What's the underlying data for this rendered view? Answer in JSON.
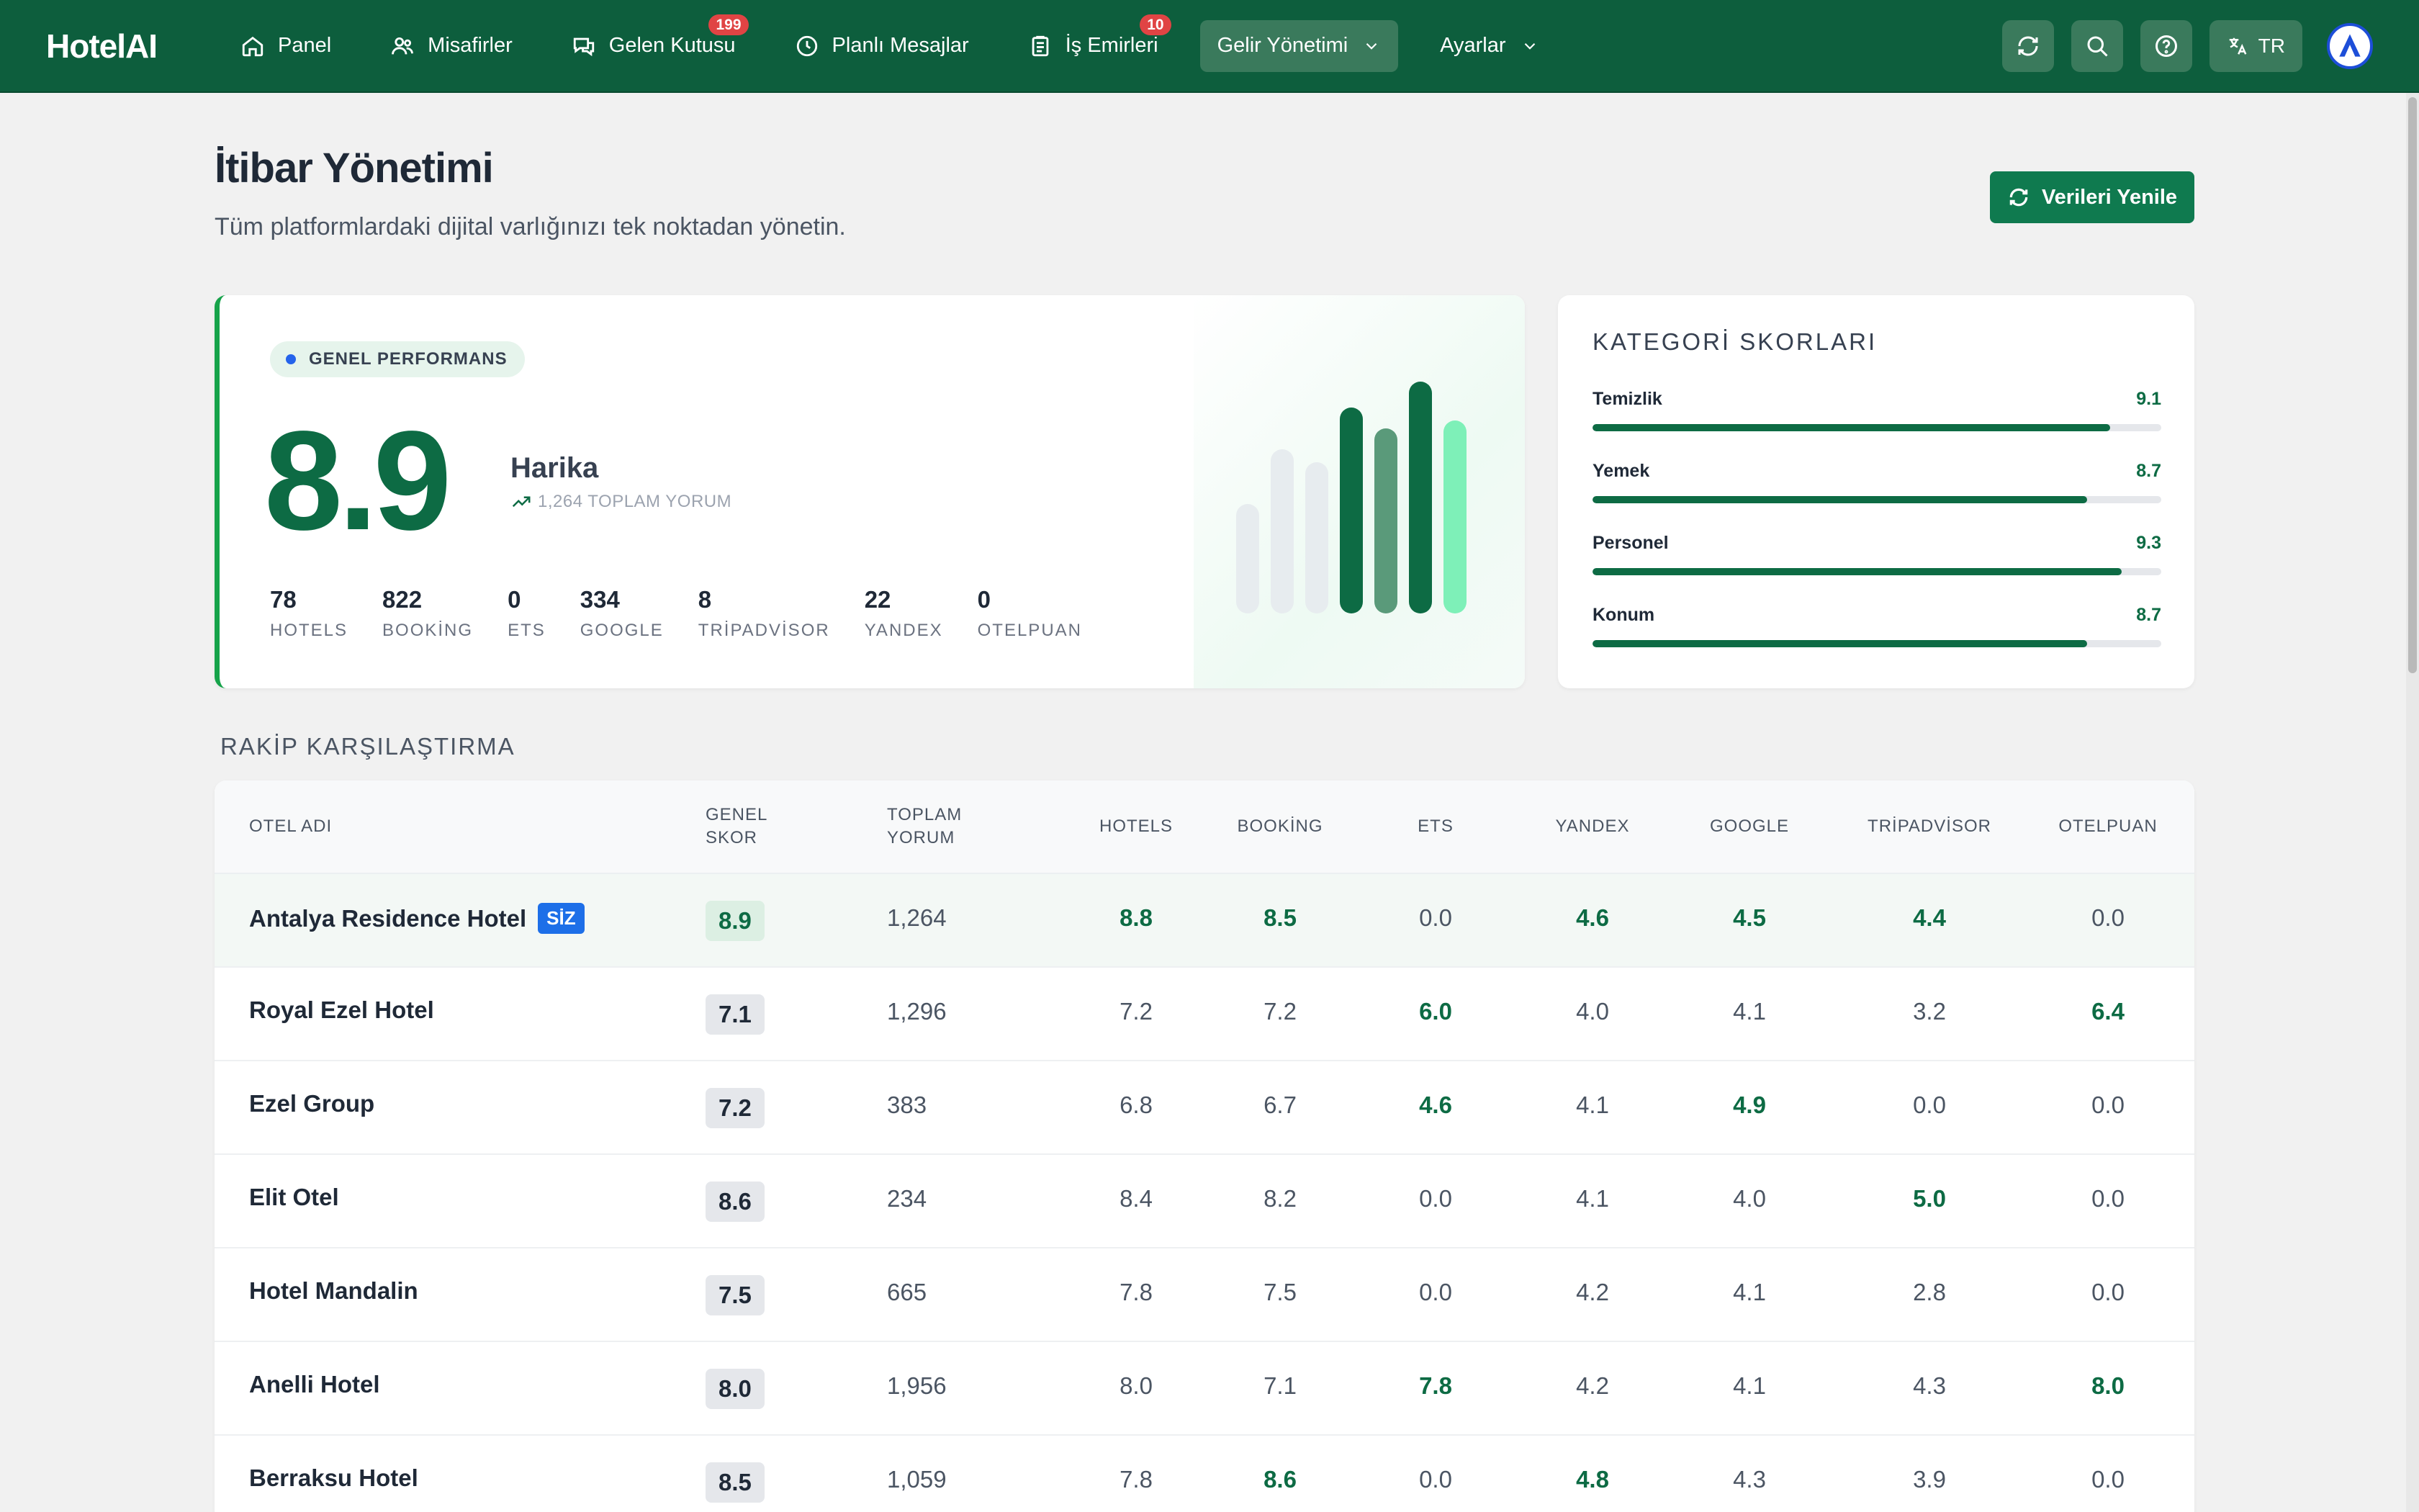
{
  "navbar": {
    "brand": "HotelAI",
    "items": [
      {
        "label": "Panel",
        "icon": "home-icon"
      },
      {
        "label": "Misafirler",
        "icon": "users-icon"
      },
      {
        "label": "Gelen Kutusu",
        "icon": "chat-icon",
        "badge": "199"
      },
      {
        "label": "Planlı Mesajlar",
        "icon": "clock-icon"
      },
      {
        "label": "İş Emirleri",
        "icon": "clipboard-icon",
        "badge": "10"
      },
      {
        "label": "Gelir Yönetimi",
        "icon": "chevron-down-icon",
        "active": true
      },
      {
        "label": "Ayarlar",
        "icon": "chevron-down-icon"
      }
    ],
    "lang": "TR"
  },
  "header": {
    "title": "İtibar Yönetimi",
    "subtitle": "Tüm platformlardaki dijital varlığınızı tek noktadan yönetin.",
    "refresh_label": "Verileri Yenile"
  },
  "performance": {
    "pill": "GENEL PERFORMANS",
    "score": "8.9",
    "rating": "Harika",
    "total_reviews": "1,264 TOPLAM YORUM",
    "platforms": [
      {
        "count": "78",
        "name": "HOTELS"
      },
      {
        "count": "822",
        "name": "BOOKİNG"
      },
      {
        "count": "0",
        "name": "ETS"
      },
      {
        "count": "334",
        "name": "GOOGLE"
      },
      {
        "count": "8",
        "name": "TRİPADVİSOR"
      },
      {
        "count": "22",
        "name": "YANDEX"
      },
      {
        "count": "0",
        "name": "OTELPUAN"
      }
    ],
    "bar_colors": [
      "#e7ecef",
      "#e7ecef",
      "#e7ecef",
      "#0d6b44",
      "#5a9a7a",
      "#0d6b44",
      "#7ef0b8"
    ],
    "bar_levels": [
      0.42,
      0.63,
      0.58,
      0.79,
      0.71,
      0.89,
      0.74
    ]
  },
  "categories": {
    "title": "KATEGORİ SKORLARI",
    "items": [
      {
        "label": "Temizlik",
        "value": "9.1",
        "fraction": 0.91
      },
      {
        "label": "Yemek",
        "value": "8.7",
        "fraction": 0.87
      },
      {
        "label": "Personel",
        "value": "9.3",
        "fraction": 0.93
      },
      {
        "label": "Konum",
        "value": "8.7",
        "fraction": 0.87
      }
    ]
  },
  "competitors": {
    "title": "RAKİP KARŞILAŞTIRMA",
    "columns": [
      "OTEL ADI",
      "GENEL\nSKOR",
      "TOPLAM\nYORUM",
      "HOTELS",
      "BOOKİNG",
      "ETS",
      "YANDEX",
      "GOOGLE",
      "TRİPADVİSOR",
      "OTELPUAN"
    ],
    "own_label": "SİZ",
    "rows": [
      {
        "name": "Antalya Residence Hotel",
        "own": true,
        "score": "8.9",
        "reviews": "1,264",
        "vals": [
          "8.8",
          "8.5",
          "0.0",
          "4.6",
          "4.5",
          "4.4",
          "0.0"
        ],
        "hi": [
          true,
          true,
          false,
          true,
          true,
          true,
          false
        ]
      },
      {
        "name": "Royal Ezel Hotel",
        "own": false,
        "score": "7.1",
        "reviews": "1,296",
        "vals": [
          "7.2",
          "7.2",
          "6.0",
          "4.0",
          "4.1",
          "3.2",
          "6.4"
        ],
        "hi": [
          false,
          false,
          true,
          false,
          false,
          false,
          true
        ]
      },
      {
        "name": "Ezel Group",
        "own": false,
        "score": "7.2",
        "reviews": "383",
        "vals": [
          "6.8",
          "6.7",
          "4.6",
          "4.1",
          "4.9",
          "0.0",
          "0.0"
        ],
        "hi": [
          false,
          false,
          true,
          false,
          true,
          false,
          false
        ]
      },
      {
        "name": "Elit Otel",
        "own": false,
        "score": "8.6",
        "reviews": "234",
        "vals": [
          "8.4",
          "8.2",
          "0.0",
          "4.1",
          "4.0",
          "5.0",
          "0.0"
        ],
        "hi": [
          false,
          false,
          false,
          false,
          false,
          true,
          false
        ]
      },
      {
        "name": "Hotel Mandalin",
        "own": false,
        "score": "7.5",
        "reviews": "665",
        "vals": [
          "7.8",
          "7.5",
          "0.0",
          "4.2",
          "4.1",
          "2.8",
          "0.0"
        ],
        "hi": [
          false,
          false,
          false,
          false,
          false,
          false,
          false
        ]
      },
      {
        "name": "Anelli Hotel",
        "own": false,
        "score": "8.0",
        "reviews": "1,956",
        "vals": [
          "8.0",
          "7.1",
          "7.8",
          "4.2",
          "4.1",
          "4.3",
          "8.0"
        ],
        "hi": [
          false,
          false,
          true,
          false,
          false,
          false,
          true
        ]
      },
      {
        "name": "Berraksu Hotel",
        "own": false,
        "score": "8.5",
        "reviews": "1,059",
        "vals": [
          "7.8",
          "8.6",
          "0.0",
          "4.8",
          "4.3",
          "3.9",
          "0.0"
        ],
        "hi": [
          false,
          true,
          false,
          true,
          false,
          false,
          false
        ]
      }
    ]
  }
}
